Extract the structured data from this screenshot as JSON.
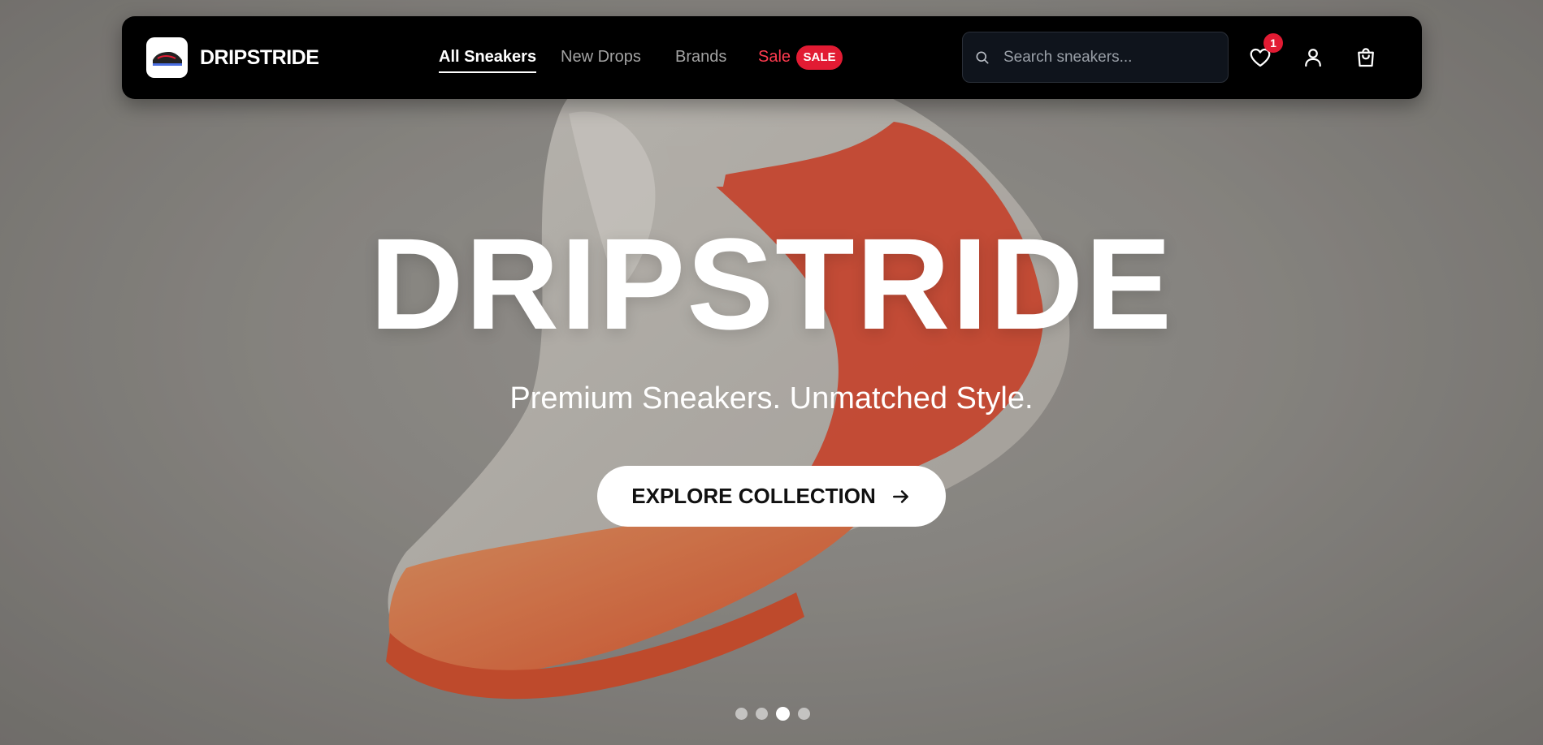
{
  "brand": {
    "name": "DRIPSTRIDE",
    "logo_text": "DripStride"
  },
  "nav": {
    "links": [
      {
        "label": "All Sneakers"
      },
      {
        "label": "New Drops"
      },
      {
        "label": "Brands"
      },
      {
        "label": "Sale"
      }
    ],
    "sale_badge": "SALE"
  },
  "search": {
    "placeholder": "Search sneakers..."
  },
  "icons": {
    "search": "search-icon",
    "wishlist": "heart-icon",
    "account": "user-icon",
    "cart": "shopping-bag-icon",
    "cta": "arrow-right-icon"
  },
  "wishlist_count": "1",
  "hero": {
    "title": "DRIPSTRIDE",
    "subtitle": "Premium Sneakers. Unmatched Style.",
    "cta_label": "EXPLORE COLLECTION",
    "slide_count": 4,
    "active_slide": 3
  },
  "colors": {
    "accent": "#e21b33",
    "navbar": "#000000",
    "shoe_swoosh": "#e8472c",
    "sole": "#f08a47"
  }
}
